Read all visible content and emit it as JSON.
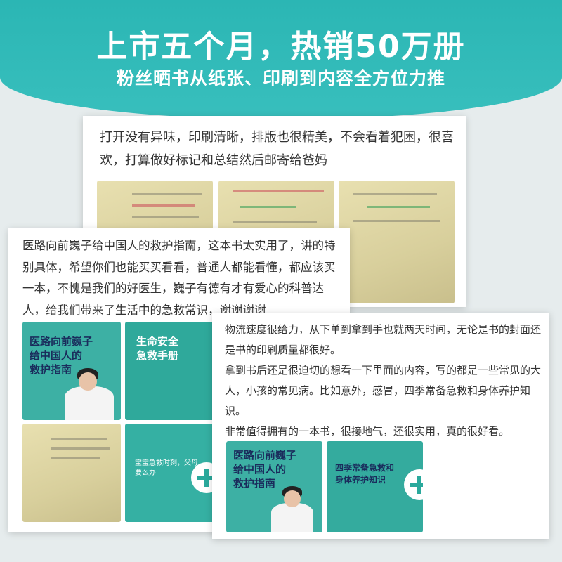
{
  "header": {
    "headline": "上市五个月，热销50万册",
    "subline": "粉丝晒书从纸张、印刷到内容全方位力推"
  },
  "review1": {
    "text": "打开没有异味，印刷清晰，排版也很精美，不会看着犯困，很喜欢，打算做好标记和总结然后邮寄给爸妈",
    "photos": [
      "open-book-photo",
      "open-book-photo",
      "open-book-photo"
    ]
  },
  "review2": {
    "text": "医路向前巍子给中国人的救护指南，这本书太实用了，讲的特别具体，希望你们也能买买看看，普通人都能看懂，都应该买一本，不愧是我们的好医生，巍子有德有才有爱心的科普达人，给我们带来了生活中的急救常识，谢谢谢谢",
    "book_title": "医路向前巍子\n给中国人的\n救护指南",
    "booklet_title": "生命安全\n急救手册",
    "photo_caption": "宝宝急救时刻，父母要么办"
  },
  "review3": {
    "paragraphs": [
      "物流速度很给力，从下单到拿到手也就两天时间，无论是书的封面还是书的印刷质量都很好。",
      "拿到书后还是很迫切的想看一下里面的内容，写的都是一些常见的大人，小孩的常见病。比如意外，感冒，四季常备急救和身体养护知识。",
      "非常值得拥有的一本书，很接地气，还很实用，真的很好看。"
    ],
    "book_title": "医路向前巍子\n给中国人的\n救护指南",
    "page_title": "四季常备急救和\n身体养护知识"
  },
  "colors": {
    "brand_teal": "#2bb6b4",
    "book_teal": "#3db0a4",
    "title_navy": "#1a2c5c"
  }
}
